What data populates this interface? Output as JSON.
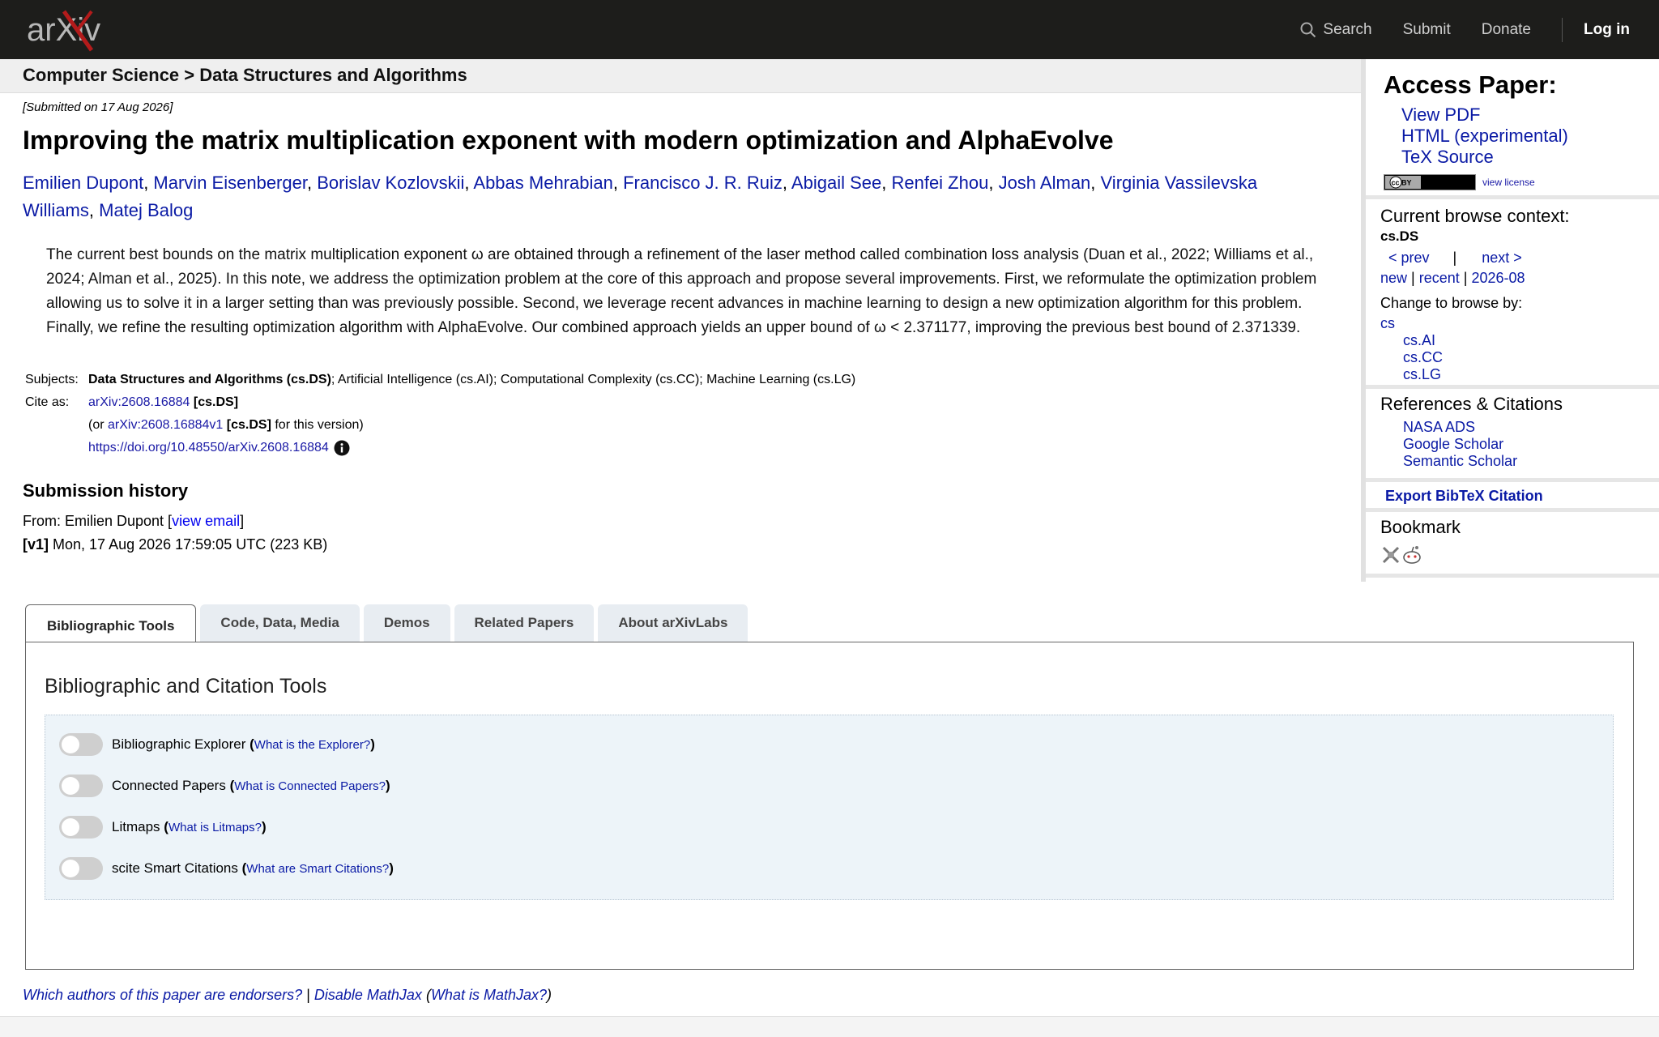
{
  "header": {
    "logo_text": "arXiv",
    "search_label": "Search",
    "submit_label": "Submit",
    "donate_label": "Donate",
    "login_label": "Log in"
  },
  "breadcrumb": "Computer Science > Data Structures and Algorithms",
  "paper": {
    "submitted": "[Submitted on 17 Aug 2026]",
    "title": "Improving the matrix multiplication exponent with modern optimization and AlphaEvolve",
    "authors": [
      "Emilien Dupont",
      "Marvin Eisenberger",
      "Borislav Kozlovskii",
      "Abbas Mehrabian",
      "Francisco J. R. Ruiz",
      "Abigail See",
      "Renfei Zhou",
      "Josh Alman",
      "Virginia Vassilevska Williams",
      "Matej Balog"
    ],
    "abstract": "The current best bounds on the matrix multiplication exponent ω are obtained through a refinement of the laser method called combination loss analysis (Duan et al., 2022; Williams et al., 2024; Alman et al., 2025). In this note, we address the optimization problem at the core of this approach and propose several improvements. First, we reformulate the optimization problem allowing us to solve it in a larger setting than was previously possible. Second, we leverage recent advances in machine learning to design a new optimization algorithm for this problem. Finally, we refine the resulting optimization algorithm with AlphaEvolve. Our combined approach yields an upper bound of ω < 2.371177, improving the previous best bound of 2.371339."
  },
  "meta": {
    "subjects_label": "Subjects:",
    "subjects_primary": "Data Structures and Algorithms (cs.DS)",
    "subjects_rest": "; Artificial Intelligence (cs.AI); Computational Complexity (cs.CC); Machine Learning (cs.LG)",
    "cite_label": "Cite as:",
    "cite_id": "arXiv:2608.16884",
    "cite_tag": "[cs.DS]",
    "or_prefix": "(or ",
    "cite_version": "arXiv:2608.16884v1",
    "cite_version_tag": "[cs.DS]",
    "or_suffix": " for this version)",
    "doi": "https://doi.org/10.48550/arXiv.2608.16884"
  },
  "history": {
    "title": "Submission history",
    "from_prefix": "From: Emilien Dupont [",
    "view_email": "view email",
    "from_suffix": "]",
    "version_tag": "[v1]",
    "version_text": " Mon, 17 Aug 2026 17:59:05 UTC (223 KB)"
  },
  "sidebar": {
    "access_title": "Access Paper:",
    "access_links": [
      "View PDF",
      "HTML (experimental)",
      "TeX Source"
    ],
    "license_badge": "cc BY",
    "view_license": "view license",
    "context_title": "Current browse context:",
    "context_code": "cs.DS",
    "prev": "< prev",
    "sep": "|",
    "next": "next >",
    "new": "new",
    "recent": "recent",
    "month": "2026-08",
    "change_label": "Change to browse by:",
    "browse_root": "cs",
    "browse_sub": [
      "cs.AI",
      "cs.CC",
      "cs.LG"
    ],
    "refs_title": "References & Citations",
    "refs_links": [
      "NASA ADS",
      "Google Scholar",
      "Semantic Scholar"
    ],
    "bibtex": "Export BibTeX Citation",
    "bookmark_title": "Bookmark"
  },
  "tabs": [
    {
      "label": "Bibliographic Tools",
      "active": true
    },
    {
      "label": "Code, Data, Media",
      "active": false
    },
    {
      "label": "Demos",
      "active": false
    },
    {
      "label": "Related Papers",
      "active": false
    },
    {
      "label": "About arXivLabs",
      "active": false
    }
  ],
  "panel": {
    "title": "Bibliographic and Citation Tools",
    "toggles": [
      {
        "label": "Bibliographic Explorer",
        "help": "What is the Explorer?"
      },
      {
        "label": "Connected Papers",
        "help": "What is Connected Papers?"
      },
      {
        "label": "Litmaps",
        "help": "What is Litmaps?"
      },
      {
        "label": "scite Smart Citations",
        "help": "What are Smart Citations?"
      }
    ]
  },
  "footer": {
    "endorsers": "Which authors of this paper are endorsers?",
    "pipe": " | ",
    "disable_mathjax": "Disable MathJax",
    "what_mathjax": "What is MathJax?"
  }
}
